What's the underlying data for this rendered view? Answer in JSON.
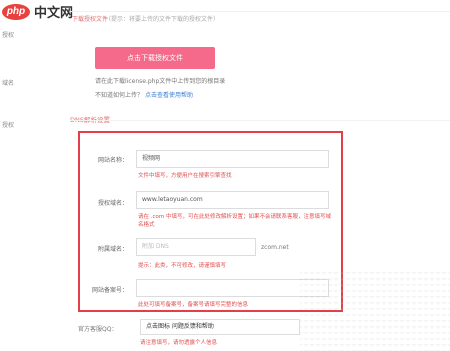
{
  "logo": {
    "badge": "php",
    "text": "中文网"
  },
  "upload_section": {
    "title": "下载授权文件",
    "hint": "（提示：将要上传的文件下载的授权文件）",
    "button": "点击下载授权文件",
    "note1": "请在此下载license.php文件中上传到您的根目录",
    "note2": "不知道如何上传？",
    "note2_link": "点击查看使用帮助"
  },
  "left_labels": [
    "授权",
    "域名",
    "授权"
  ],
  "dns": {
    "title": "DNS解析设置",
    "site_name_label": "网站名称：",
    "site_name_value": "视频网",
    "site_name_warn": "文件中填写，方便用户在搜索引擎查找",
    "domain_label": "授权域名：",
    "domain_value": "www.letaoyuan.com",
    "domain_warn": "请在 .com 中填写，可在此处修改解析设置；如果不会请联系客服，注意填写域名格式",
    "file_domain_label": "附属域名：",
    "file_domain_value": "附加 DNS",
    "file_domain_suffix": "zcom.net",
    "file_domain_warn": "提示：此类，不可修改，请谨慎填写",
    "remark_label": "网站备案号：",
    "remark_warn": "此处可填写备案号，备案号请填写完整的信息"
  },
  "bottom": {
    "label": "官方客服QQ：",
    "value": "点击图标 问题反馈和帮助",
    "warn": "请注意填写，请勿透露个人信息"
  }
}
